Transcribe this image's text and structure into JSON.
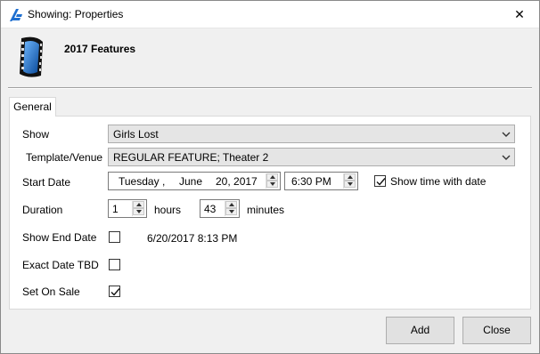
{
  "window": {
    "title": "Showing: Properties",
    "close_glyph": "✕",
    "app_icon": "app-logo-icon"
  },
  "header": {
    "title": "2017 Features",
    "icon": "film-strip-icon"
  },
  "tabs": [
    {
      "label": "General"
    }
  ],
  "form": {
    "show": {
      "label": "Show",
      "value": "Girls Lost"
    },
    "template_venue": {
      "label": "Template/Venue",
      "value": "REGULAR FEATURE; Theater 2"
    },
    "start_date": {
      "label": "Start Date",
      "weekday": "Tuesday",
      "comma": ",",
      "month": "June",
      "day_year": "20, 2017",
      "time": "6:30 PM",
      "show_time_label": "Show time with date",
      "show_time_checked": true
    },
    "duration": {
      "label": "Duration",
      "hours_value": "1",
      "hours_label": "hours",
      "minutes_value": "43",
      "minutes_label": "minutes"
    },
    "show_end_date": {
      "label": "Show End Date",
      "checked": false,
      "computed": "6/20/2017 8:13 PM"
    },
    "exact_date_tbd": {
      "label": "Exact Date TBD",
      "checked": false
    },
    "set_on_sale": {
      "label": "Set On Sale",
      "checked": true
    }
  },
  "buttons": {
    "add": "Add",
    "close": "Close"
  }
}
